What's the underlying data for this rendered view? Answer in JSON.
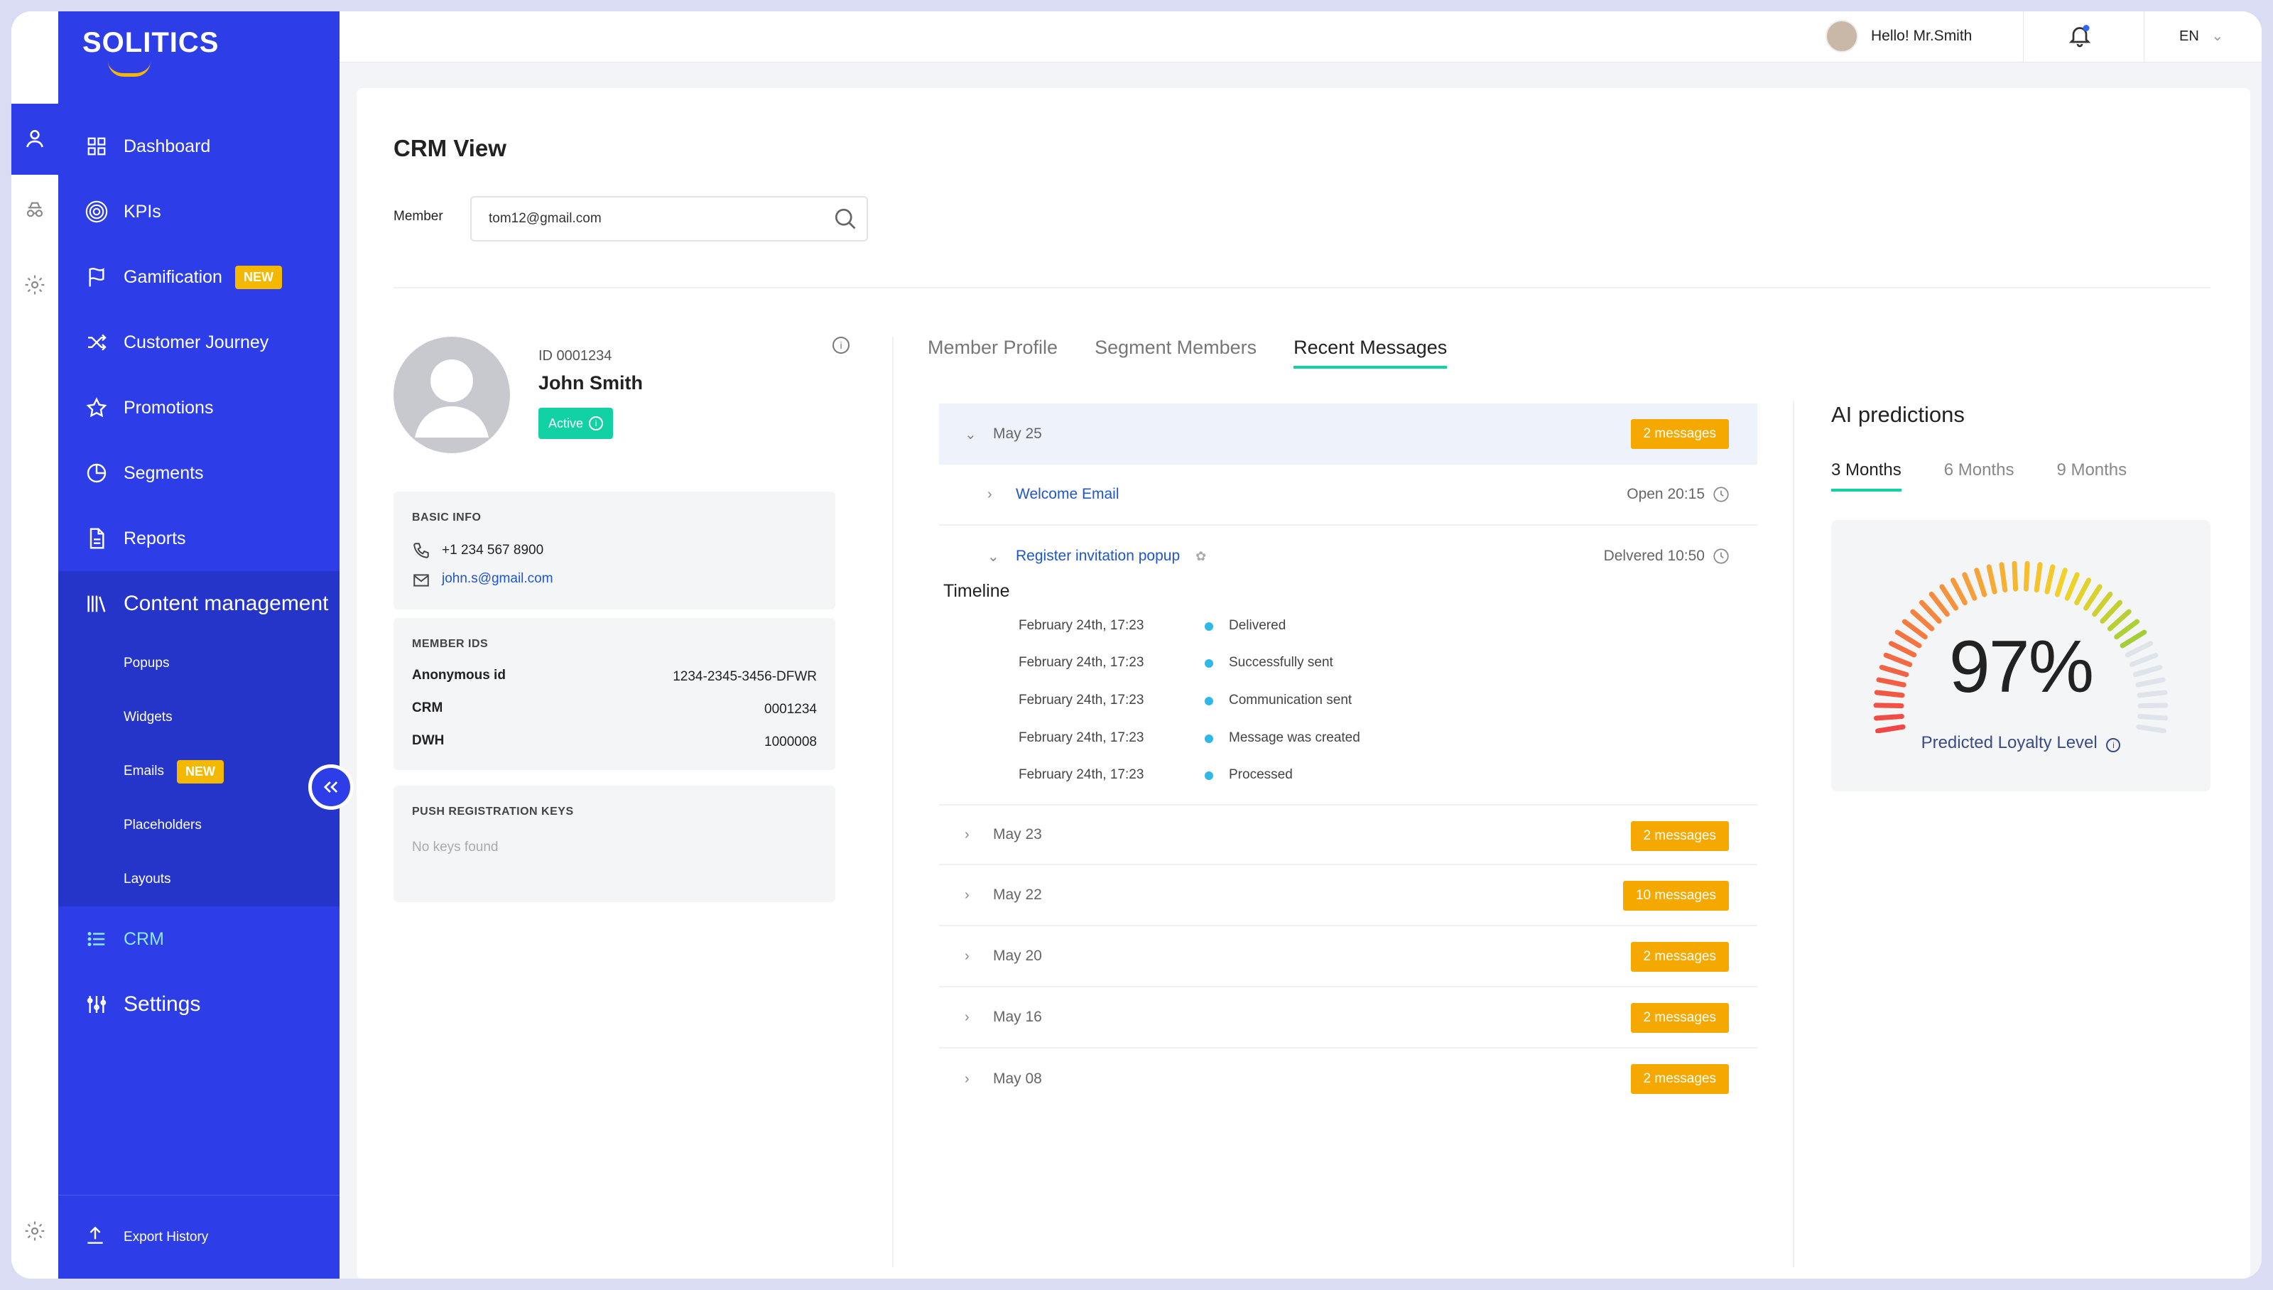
{
  "app": {
    "brand": "SOLITICS"
  },
  "topbar": {
    "greeting": "Hello! Mr.Smith",
    "language": "EN"
  },
  "sidebar": {
    "items": [
      {
        "label": "Dashboard",
        "icon": "grid-icon"
      },
      {
        "label": "KPIs",
        "icon": "target-icon"
      },
      {
        "label": "Gamification",
        "icon": "flag-icon",
        "badge": "NEW"
      },
      {
        "label": "Customer Journey",
        "icon": "shuffle-icon"
      },
      {
        "label": "Promotions",
        "icon": "star-icon"
      },
      {
        "label": "Segments",
        "icon": "pie-icon"
      },
      {
        "label": "Reports",
        "icon": "document-icon"
      },
      {
        "label": "Content management",
        "icon": "library-icon"
      }
    ],
    "content_sub": [
      {
        "label": "Popups"
      },
      {
        "label": "Widgets"
      },
      {
        "label": "Emails",
        "badge": "NEW"
      },
      {
        "label": "Placeholders"
      },
      {
        "label": "Layouts"
      }
    ],
    "crm": "CRM",
    "settings": "Settings",
    "export": "Export History"
  },
  "page": {
    "title": "CRM View",
    "member_label": "Member",
    "member_value": "tom12@gmail.com"
  },
  "profile": {
    "id": "ID 0001234",
    "name": "John Smith",
    "status": "Active",
    "basic_info_title": "BASIC INFO",
    "phone": "+1 234 567 8900",
    "email": "john.s@gmail.com",
    "member_ids_title": "MEMBER IDS",
    "ids": [
      {
        "k": "Anonymous id",
        "v": "1234-2345-3456-DFWR"
      },
      {
        "k": "CRM",
        "v": "0001234"
      },
      {
        "k": "DWH",
        "v": "1000008"
      }
    ],
    "push_title": "PUSH REGISTRATION KEYS",
    "push_empty": "No keys found"
  },
  "tabs": [
    "Member Profile",
    "Segment Members",
    "Recent Messages"
  ],
  "messages": {
    "open_day": {
      "date": "May 25",
      "count": "2 messages"
    },
    "items": [
      {
        "name": "Welcome Email",
        "status": "Open 20:15"
      },
      {
        "name": "Register invitation popup",
        "status": "Delvered 10:50"
      }
    ],
    "timeline_title": "Timeline",
    "timeline": [
      {
        "time": "February 24th, 17:23",
        "event": "Delivered"
      },
      {
        "time": "February 24th, 17:23",
        "event": "Successfully sent"
      },
      {
        "time": "February 24th, 17:23",
        "event": "Communication sent"
      },
      {
        "time": "February 24th, 17:23",
        "event": "Message was created"
      },
      {
        "time": "February 24th, 17:23",
        "event": "Processed"
      }
    ],
    "days": [
      {
        "date": "May 23",
        "count": "2 messages"
      },
      {
        "date": "May 22",
        "count": "10 messages"
      },
      {
        "date": "May 20",
        "count": "2 messages"
      },
      {
        "date": "May 16",
        "count": "2 messages"
      },
      {
        "date": "May 08",
        "count": "2 messages"
      }
    ]
  },
  "ai": {
    "title": "AI predictions",
    "tabs": [
      "3 Months",
      "6 Months",
      "9 Months"
    ],
    "value": "97%",
    "value_fraction": 0.97,
    "label": "Predicted Loyalty Level"
  },
  "colors": {
    "sidebar": "#2d3ee8",
    "accent": "#12d1a4",
    "badge": "#f5a800",
    "link": "#1f55ce"
  }
}
